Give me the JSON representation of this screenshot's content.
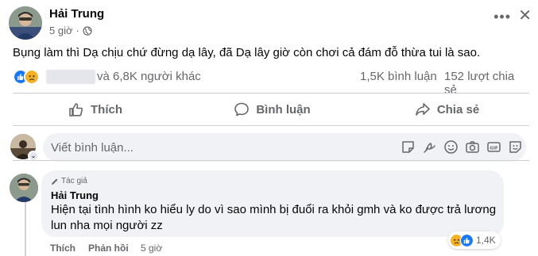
{
  "post": {
    "author": "Hải Trung",
    "time": "5 giờ",
    "text": "Bụng làm thì Dạ chịu chứ đừng dạ lây, đã Dạ lây giờ còn chơi cả đám đỗ thừa tui là sao.",
    "more_icon": "•••",
    "close_icon": "✕"
  },
  "reactions": {
    "names": "và 6,8K người khác",
    "comments": "1,5K bình luận",
    "shares": "152 lượt chia sẻ",
    "like_color": "#1877f2",
    "sad_color": "#f7b125"
  },
  "actions": {
    "like": "Thích",
    "comment": "Bình luận",
    "share": "Chia sẻ"
  },
  "composer": {
    "placeholder": "Viết bình luận...",
    "badge": "⌄",
    "tools": [
      "sticker-icon",
      "scribble-icon",
      "emoji-icon",
      "camera-icon",
      "gif-icon",
      "avatar-sticker-icon"
    ]
  },
  "comment": {
    "badge": "Tác giả",
    "author": "Hải Trung",
    "text": "Hiện tại tình hình ko hiểu ly do vì sao mình bị đuổi ra khỏi gmh và ko được trả lương lun nha mọi người zz",
    "reaction_count": "1,4K",
    "like": "Thích",
    "reply": "Phản hồi",
    "time": "5 giờ"
  }
}
